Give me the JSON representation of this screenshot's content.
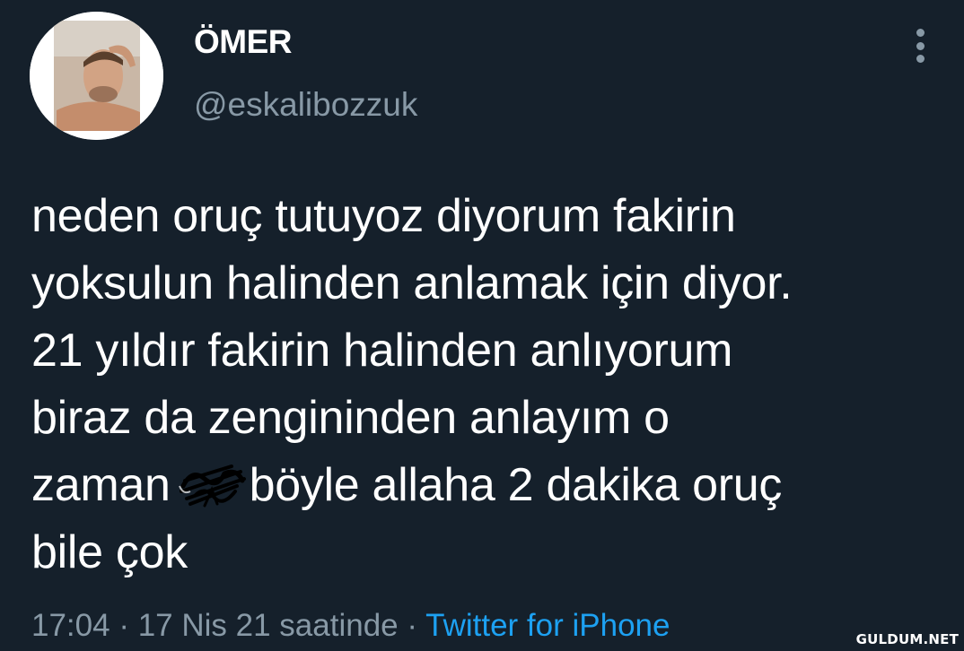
{
  "author": {
    "display_name": "ÖMER",
    "handle": "@eskalibozzuk"
  },
  "tweet": {
    "lines": [
      "neden oruç tutuyoz diyorum fakirin",
      "yoksulun halinden anlamak için diyor.",
      "21 yıldır fakirin halinden anlıyorum",
      "biraz da zengininden anlayım o",
      "zaman",
      "böyle allaha 2 dakika oruç",
      "bile çok"
    ]
  },
  "meta": {
    "time": "17:04",
    "separator": "·",
    "date": "17 Nis 21 saatinde",
    "source": "Twitter for iPhone"
  },
  "watermark": "GULDUM.NET",
  "icons": {
    "avatar": "profile-photo",
    "more": "vertical-ellipsis-icon",
    "redaction": "scribble-censor-mark"
  },
  "colors": {
    "background": "#15202b",
    "text": "#ffffff",
    "secondary": "#8899a6",
    "link": "#1da1f2"
  }
}
